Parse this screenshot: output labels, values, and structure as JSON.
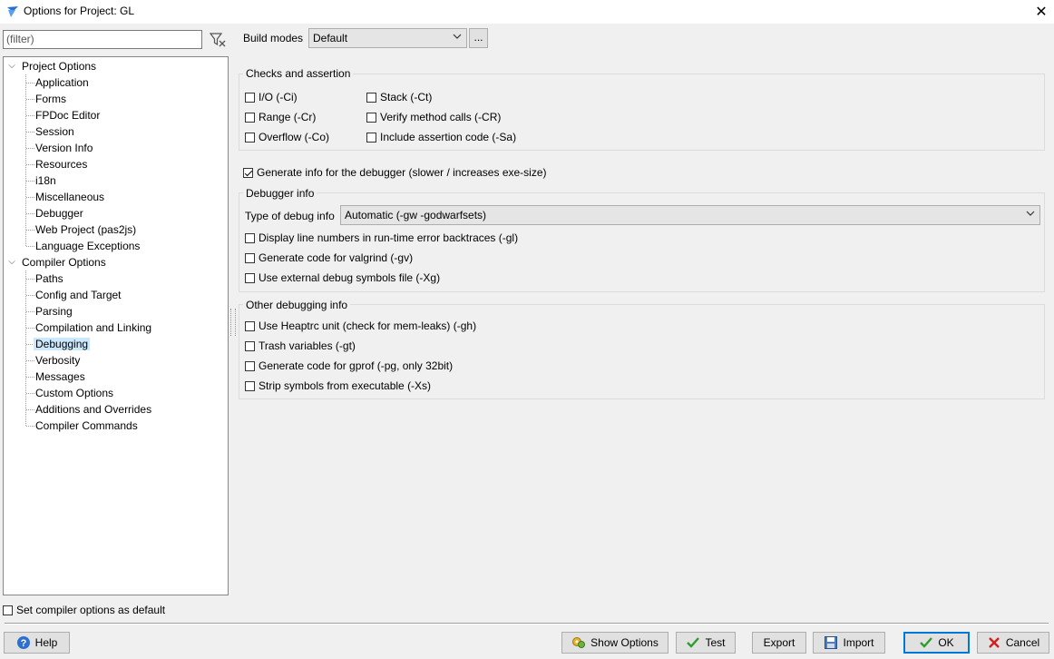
{
  "window": {
    "title": "Options for Project: GL",
    "close_glyph": "✕"
  },
  "filter": {
    "placeholder": "(filter)"
  },
  "tree": {
    "project_options": {
      "label": "Project Options",
      "children": [
        "Application",
        "Forms",
        "FPDoc Editor",
        "Session",
        "Version Info",
        "Resources",
        "i18n",
        "Miscellaneous",
        "Debugger",
        "Web Project (pas2js)",
        "Language Exceptions"
      ]
    },
    "compiler_options": {
      "label": "Compiler Options",
      "children": [
        "Paths",
        "Config and Target",
        "Parsing",
        "Compilation and Linking",
        "Debugging",
        "Verbosity",
        "Messages",
        "Custom Options",
        "Additions and Overrides",
        "Compiler Commands"
      ]
    },
    "selected": "Debugging"
  },
  "build_modes": {
    "label": "Build modes",
    "value": "Default",
    "more_label": "..."
  },
  "checks": {
    "title": "Checks and assertion",
    "io": "I/O (-Ci)",
    "range": "Range (-Cr)",
    "overflow": "Overflow (-Co)",
    "stack": "Stack (-Ct)",
    "verify": "Verify method calls (-CR)",
    "assertion": "Include assertion code (-Sa)"
  },
  "generate_debug_info": {
    "label": "Generate info for the debugger (slower / increases exe-size)",
    "checked": true
  },
  "debugger_info": {
    "title": "Debugger info",
    "type_label": "Type of debug info",
    "type_value": "Automatic (-gw -godwarfsets)",
    "line_numbers": "Display line numbers in run-time error backtraces (-gl)",
    "valgrind": "Generate code for valgrind (-gv)",
    "external_symbols": "Use external debug symbols file (-Xg)"
  },
  "other_debugging": {
    "title": "Other debugging info",
    "heaptrc": "Use Heaptrc unit (check for mem-leaks) (-gh)",
    "trash": "Trash variables (-gt)",
    "gprof": "Generate code for gprof (-pg, only 32bit)",
    "strip": "Strip symbols from executable (-Xs)"
  },
  "default_options": {
    "label": "Set compiler options as default"
  },
  "buttons": {
    "help": "Help",
    "show_options": "Show Options",
    "test": "Test",
    "export": "Export",
    "import": "Import",
    "ok": "OK",
    "cancel": "Cancel"
  },
  "colors": {
    "accent": "#0078d7",
    "selection": "#cce8ff",
    "ok_check": "#2e9d2e",
    "cancel_x": "#d11f1f"
  }
}
